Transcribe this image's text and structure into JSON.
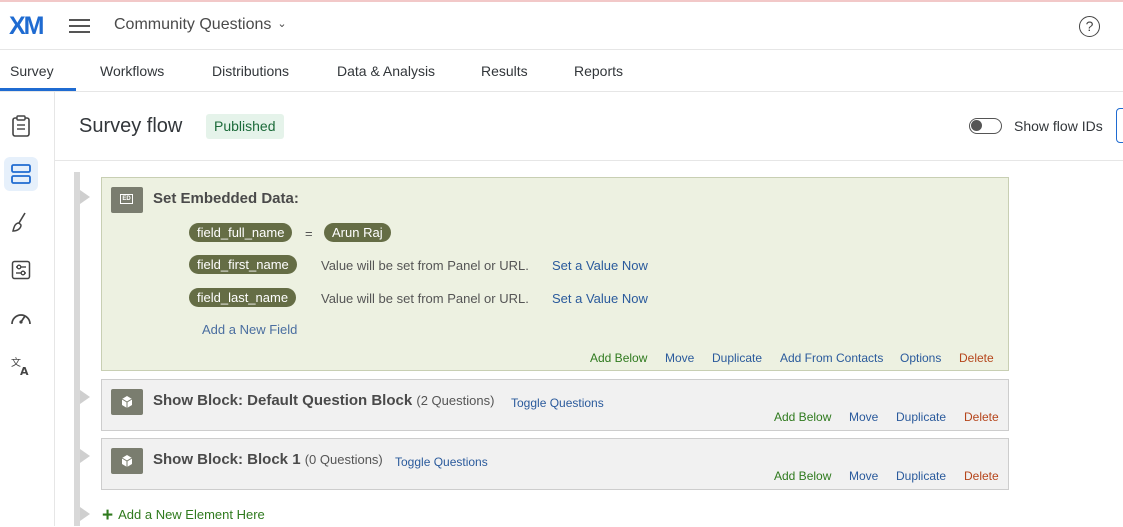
{
  "header": {
    "logo_text": "XM",
    "project_title": "Community Questions",
    "help_label": "?"
  },
  "tabs": [
    "Survey",
    "Workflows",
    "Distributions",
    "Data & Analysis",
    "Results",
    "Reports"
  ],
  "active_tab": "Survey",
  "sidebar": {
    "icons": [
      "clipboard-icon",
      "survey-flow-icon",
      "paintbrush-icon",
      "options-sliders-icon",
      "speedometer-icon",
      "translate-icon"
    ],
    "active": "survey-flow-icon"
  },
  "page": {
    "title": "Survey flow",
    "status": "Published",
    "toggle_label": "Show flow IDs",
    "toggle_on": false
  },
  "embedded_block": {
    "icon_label": "ED",
    "title": "Set Embedded Data:",
    "fields": [
      {
        "name": "field_full_name",
        "equals": "=",
        "value": "Arun Raj"
      },
      {
        "name": "field_first_name",
        "note": "Value will be set from Panel or URL.",
        "link": "Set a Value Now"
      },
      {
        "name": "field_last_name",
        "note": "Value will be set from Panel or URL.",
        "link": "Set a Value Now"
      }
    ],
    "add_field": "Add a New Field",
    "actions": [
      "Add Below",
      "Move",
      "Duplicate",
      "Add From Contacts",
      "Options",
      "Delete"
    ]
  },
  "blocks": [
    {
      "title": "Show Block: Default Question Block",
      "count": "(2 Questions)",
      "toggle": "Toggle Questions",
      "actions": [
        "Add Below",
        "Move",
        "Duplicate",
        "Delete"
      ]
    },
    {
      "title": "Show Block: Block 1",
      "count": "(0 Questions)",
      "toggle": "Toggle Questions",
      "actions": [
        "Add Below",
        "Move",
        "Duplicate",
        "Delete"
      ]
    }
  ],
  "add_element": "Add a New Element Here",
  "colors": {
    "brand": "#1f6bd1",
    "embedded_bg": "#edf1e1",
    "pill": "#656d45",
    "action_green": "#2f7a1e",
    "action_blue": "#2a5a9c",
    "action_red": "#b5451b"
  }
}
